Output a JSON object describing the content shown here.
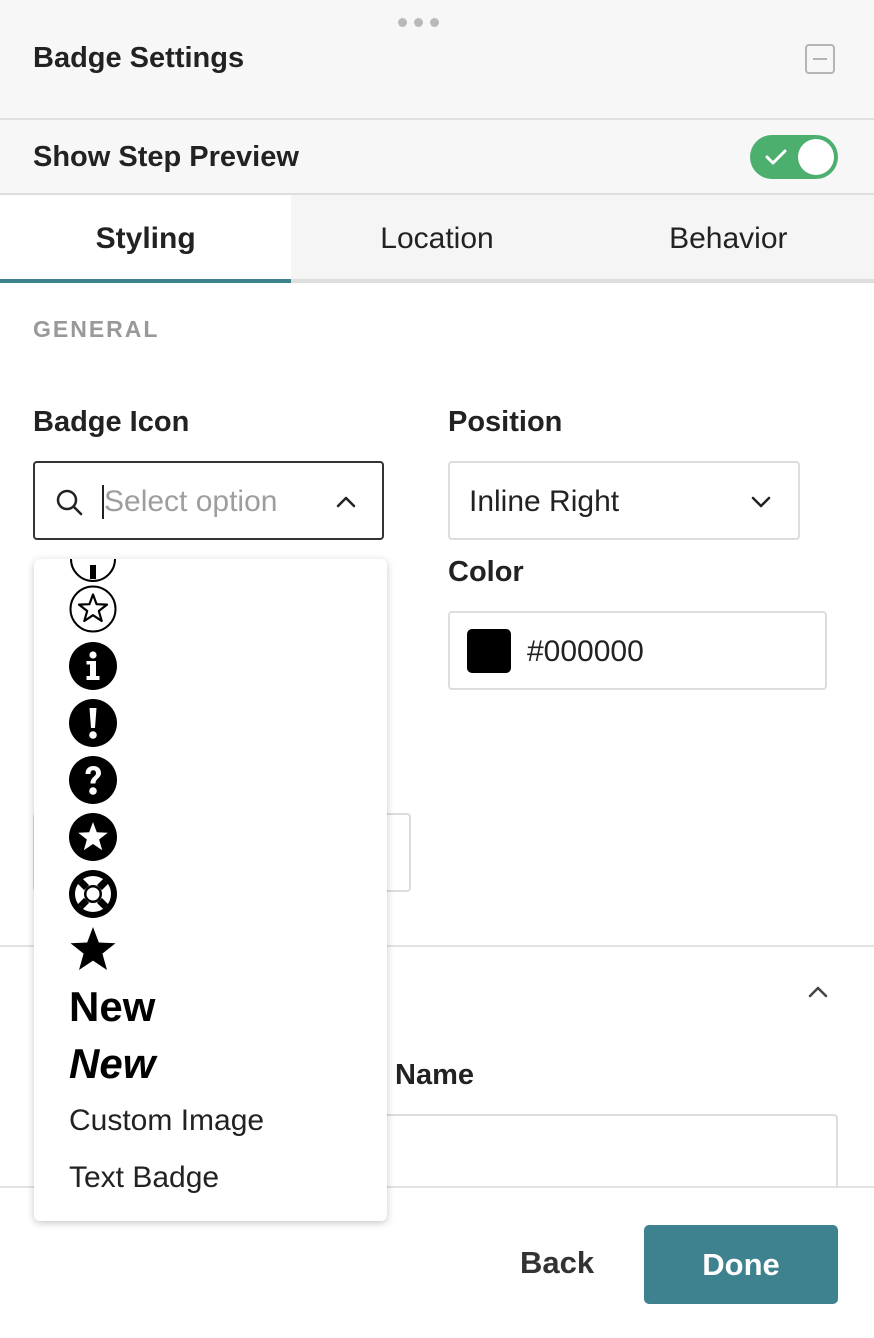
{
  "header": {
    "title": "Badge Settings"
  },
  "preview": {
    "label": "Show Step Preview",
    "enabled": true
  },
  "tabs": [
    {
      "label": "Styling",
      "active": true
    },
    {
      "label": "Location",
      "active": false
    },
    {
      "label": "Behavior",
      "active": false
    }
  ],
  "general": {
    "section_label": "GENERAL",
    "badge_icon": {
      "label": "Badge Icon",
      "placeholder": "Select option"
    },
    "position": {
      "label": "Position",
      "value": "Inline Right"
    },
    "color": {
      "label": "Color",
      "value": "#000000"
    }
  },
  "dropdown": {
    "options": [
      {
        "icon": "circle-partial-icon"
      },
      {
        "icon": "star-outline-circle-icon"
      },
      {
        "icon": "info-circle-icon"
      },
      {
        "icon": "exclamation-circle-icon"
      },
      {
        "icon": "question-circle-icon"
      },
      {
        "icon": "star-circle-icon"
      },
      {
        "icon": "life-ring-icon"
      },
      {
        "icon": "star-solid-icon"
      },
      {
        "label": "New"
      },
      {
        "label": "New"
      },
      {
        "label": "Custom Image"
      },
      {
        "label": "Text Badge"
      }
    ]
  },
  "section2": {
    "name_label": "Name"
  },
  "footer": {
    "back_label": "Back",
    "done_label": "Done"
  },
  "colors": {
    "accent": "#3e8290",
    "toggle_on": "#4caf6e"
  }
}
